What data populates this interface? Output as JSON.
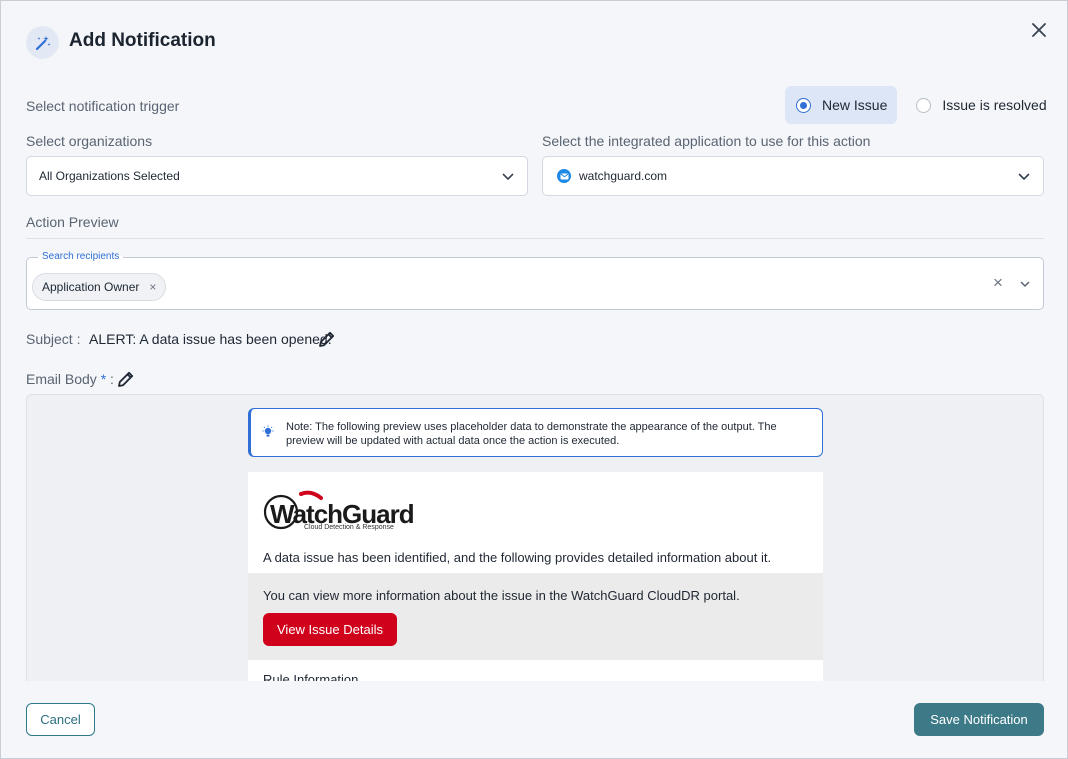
{
  "dialog": {
    "title": "Add Notification",
    "icon": "magic-wand-icon"
  },
  "trigger": {
    "label": "Select notification trigger",
    "options": [
      {
        "label": "New Issue",
        "selected": true
      },
      {
        "label": "Issue is resolved",
        "selected": false
      }
    ]
  },
  "organizations": {
    "label": "Select organizations",
    "value": "All Organizations Selected"
  },
  "integration": {
    "label": "Select the integrated application to use for this action",
    "value": "watchguard.com"
  },
  "action_preview": {
    "label": "Action Preview"
  },
  "recipients": {
    "legend": "Search recipients",
    "chips": [
      "Application Owner"
    ],
    "chip_remove": "×",
    "clear": "×"
  },
  "subject": {
    "label": "Subject :",
    "value": "ALERT: A data issue has been opened."
  },
  "email_body": {
    "label": "Email Body",
    "required_mark": "*",
    "colon": ":"
  },
  "note": {
    "text": "Note: The following preview uses placeholder data to demonstrate the appearance of the output. The preview will be updated with actual data once the action is executed."
  },
  "email": {
    "logo_text": "WatchGuard",
    "logo_sub": "Cloud Detection & Response",
    "intro": "A data issue has been identified, and the following provides detailed information about it.",
    "portal_text": "You can view more information about the issue in the WatchGuard CloudDR portal.",
    "details_button": "View Issue Details",
    "next_heading": "Rule Information"
  },
  "footer": {
    "cancel": "Cancel",
    "save": "Save Notification"
  },
  "colors": {
    "accent": "#2f6fd6",
    "primary_button": "#3d7a87",
    "brand_red": "#d0021b"
  }
}
